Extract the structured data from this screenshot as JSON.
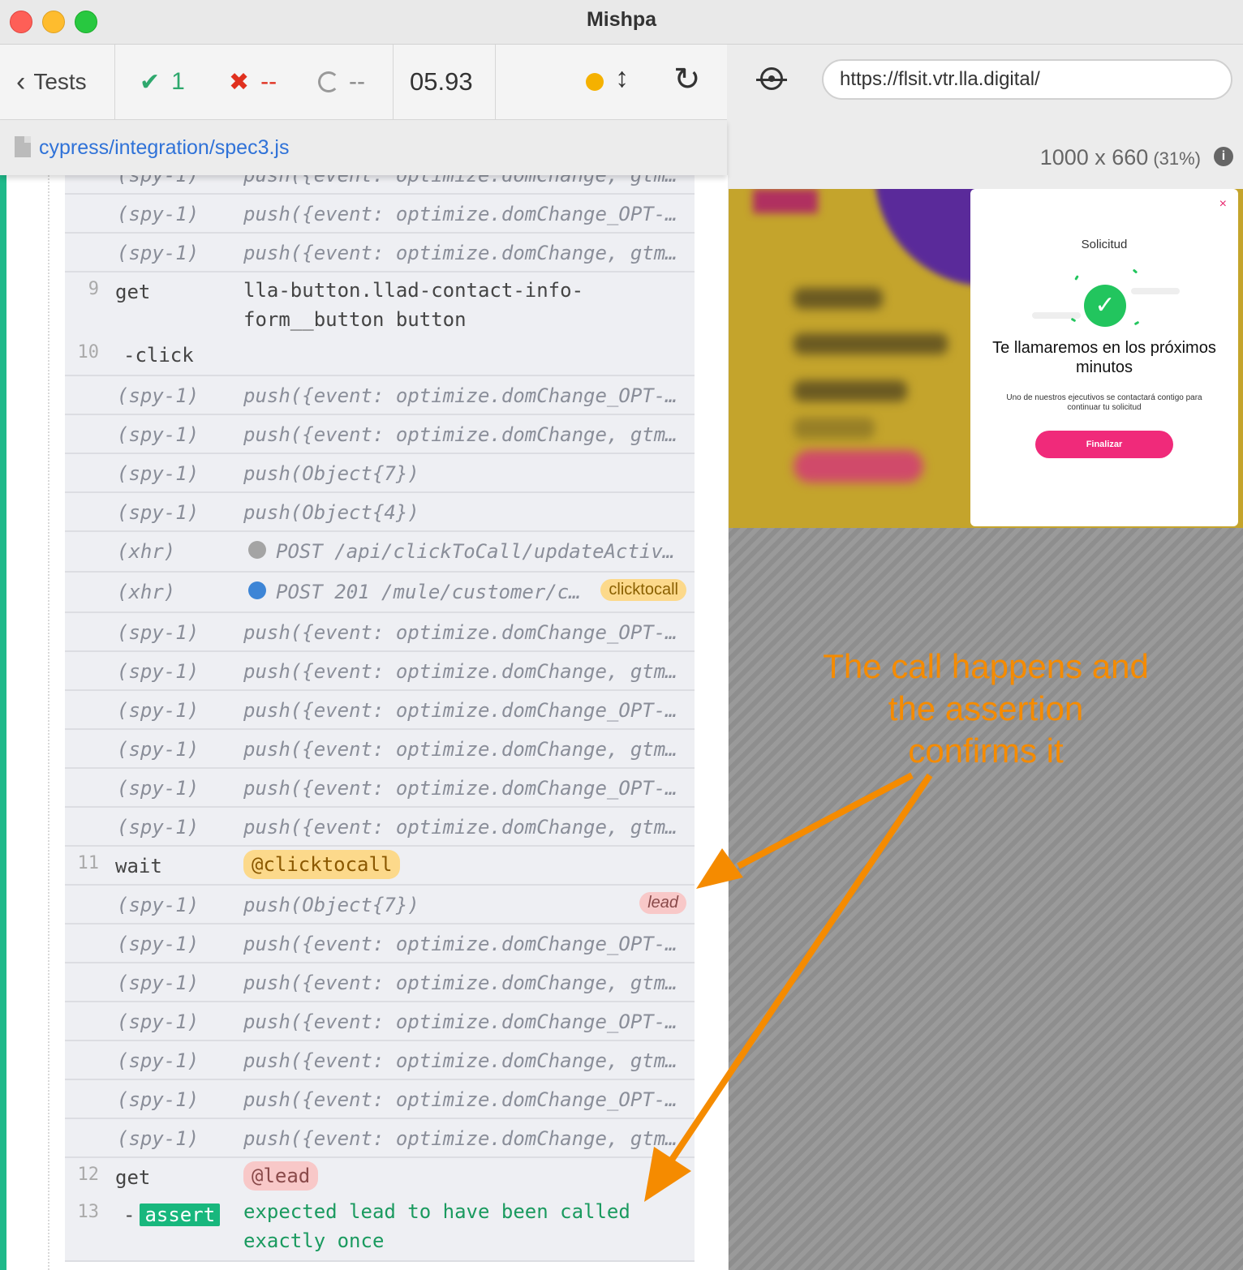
{
  "window": {
    "title": "Mishpa"
  },
  "reporter": {
    "tests_label": "Tests",
    "passed": "1",
    "failed": "--",
    "pending": "--",
    "duration": "05.93",
    "spec_file": "cypress/integration/spec3.js"
  },
  "browser": {
    "url": "https://flsit.vtr.lla.digital/",
    "viewport": "1000 x 660",
    "zoom": "(31%)"
  },
  "log": {
    "spy": "(spy-1)",
    "xhr": "(xhr)",
    "msg_gtm": "push({event: optimize.domChange, gtm…",
    "msg_opt": "push({event: optimize.domChange_OPT-…",
    "msg_obj7": "push(Object{7})",
    "msg_obj4": "push(Object{4})",
    "cmd9_num": "9",
    "cmd9_name": "get",
    "cmd9_msg": "lla-button.llad-contact-info-form__button button",
    "cmd10_num": "10",
    "cmd10_name": "-click",
    "xhr1": "POST /api/clickToCall/updateActiv…",
    "xhr2": "POST 201 /mule/customer/c…",
    "xhr2_badge": "clicktocall",
    "cmd11_num": "11",
    "cmd11_name": "wait",
    "cmd11_alias": "@clicktocall",
    "lead_badge": "lead",
    "cmd12_num": "12",
    "cmd12_name": "get",
    "cmd12_alias": "@lead",
    "cmd13_num": "13",
    "cmd13_dash": "-",
    "cmd13_name": "assert",
    "cmd13_msg": "expected lead to have been called exactly once"
  },
  "modal": {
    "close": "×",
    "title": "Solicitud",
    "heading": "Te llamaremos en los próximos minutos",
    "subtext": "Uno de nuestros ejecutivos se contactará contigo para continuar tu solicitud",
    "button": "Finalizar"
  },
  "annotation": {
    "text": "The call happens and the assertion confirms it"
  },
  "colors": {
    "pass": "#2ea86d",
    "fail": "#e0301e",
    "accent": "#1fb98a",
    "annotation": "#f58b00",
    "cta": "#f02a7a"
  }
}
